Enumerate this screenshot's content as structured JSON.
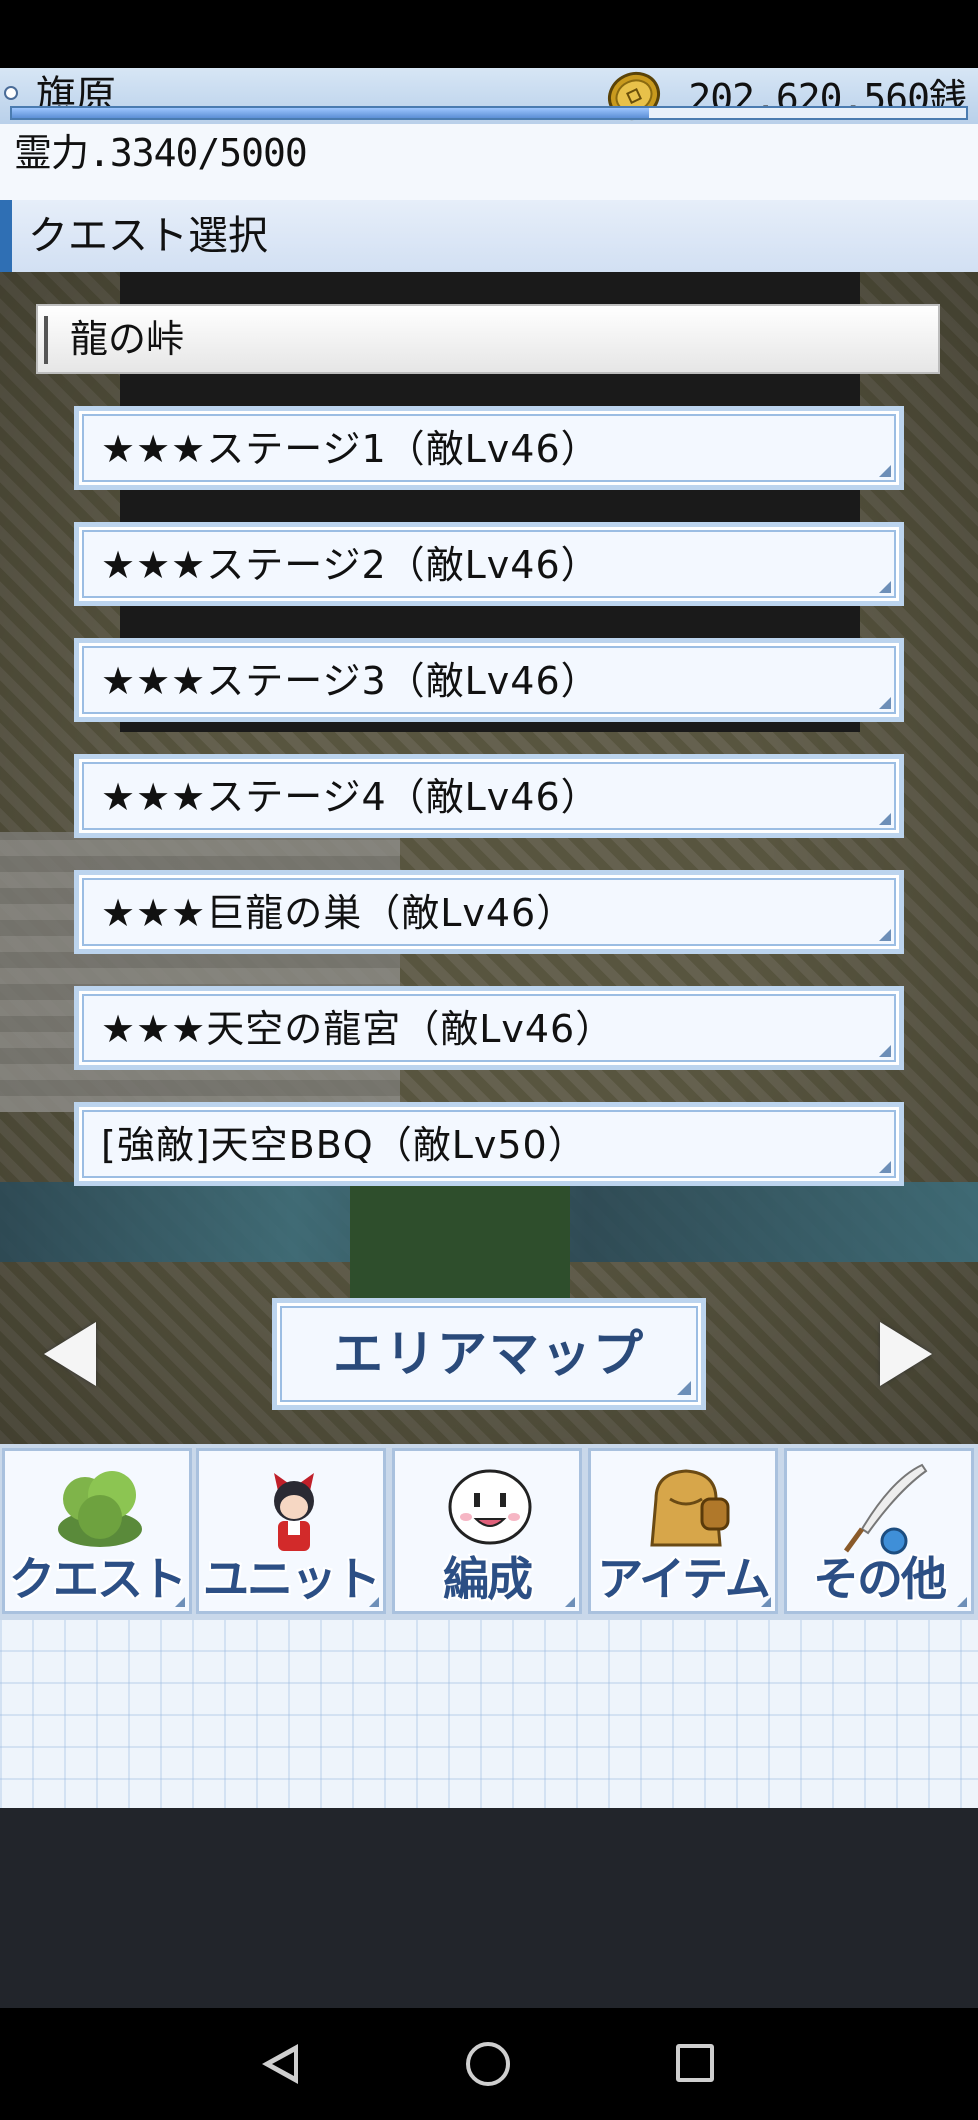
{
  "header": {
    "player_name": "旗原",
    "money": "202,620,560銭",
    "stamina_text": "霊力.3340/5000",
    "stamina_fraction": 0.668
  },
  "section": {
    "title": "クエスト選択"
  },
  "area": {
    "name": "龍の峠"
  },
  "stages": [
    {
      "label": "★★★ステージ1（敵Lv46）"
    },
    {
      "label": "★★★ステージ2（敵Lv46）"
    },
    {
      "label": "★★★ステージ3（敵Lv46）"
    },
    {
      "label": "★★★ステージ4（敵Lv46）"
    },
    {
      "label": "★★★巨龍の巣（敵Lv46）"
    },
    {
      "label": "★★★天空の龍宮（敵Lv46）"
    },
    {
      "label": "[強敵]天空BBQ（敵Lv50）"
    }
  ],
  "area_map_button": {
    "label": "エリアマップ"
  },
  "nav": [
    {
      "label": "クエスト",
      "icon": "tree-icon"
    },
    {
      "label": "ユニット",
      "icon": "character-icon"
    },
    {
      "label": "編成",
      "icon": "face-icon"
    },
    {
      "label": "アイテム",
      "icon": "bag-icon"
    },
    {
      "label": "その他",
      "icon": "quill-icon"
    }
  ],
  "colors": {
    "accent": "#2f6fb4",
    "button_bg": "#f3f8ff",
    "nav_text": "#2c4f85"
  }
}
